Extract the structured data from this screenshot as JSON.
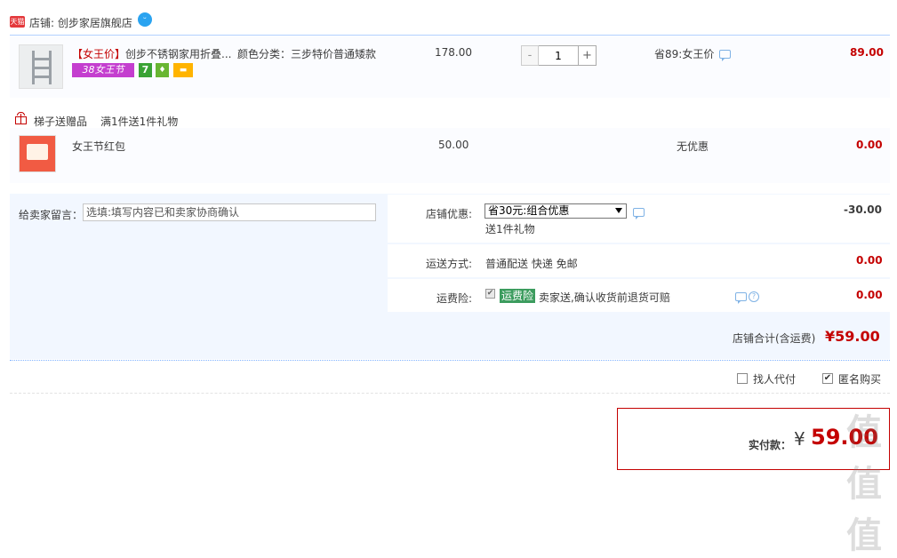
{
  "shop": {
    "badge": "天猫",
    "name": "店铺: 创步家居旗舰店",
    "chat_icon": "wangwang-chat-icon"
  },
  "item": {
    "title_prefix": "【女王价】",
    "title_rest": "创步不锈钢家用折叠...",
    "tag_38": "38女王节",
    "tag_7": "7",
    "tag_bag": "♦",
    "tag_card": "▬",
    "sku": "颜色分类：三步特价普通矮款",
    "price": "178.00",
    "qty_minus": "-",
    "qty": "1",
    "qty_plus": "+",
    "discount": "省89:女王价",
    "subtotal": "89.00"
  },
  "gift": {
    "label": "梯子送赠品",
    "rule": "满1件送1件礼物",
    "title": "女王节红包",
    "price": "50.00",
    "discount": "无优惠",
    "subtotal": "0.00"
  },
  "options": {
    "memo_label": "给卖家留言：",
    "memo_placeholder": "选填:填写内容已和卖家协商确认",
    "promo_label": "店铺优惠:",
    "promo_selected": "省30元:组合优惠",
    "promo_gift": "送1件礼物",
    "promo_amount": "-30.00",
    "ship_label": "运送方式:",
    "ship_value": "普通配送 快递 免邮",
    "ship_amount": "0.00",
    "ins_label": "运费险:",
    "ins_checked": "✔",
    "ins_badge": "运费险",
    "ins_text": "卖家送,确认收货前退货可赔",
    "ins_amount": "0.00",
    "help_glyph": "?"
  },
  "totals": {
    "shop_total_label": "店铺合计(含运费)",
    "shop_total": "¥59.00"
  },
  "checkout": {
    "proxy_pay": "找人代付",
    "anonymous": "匿名购买",
    "anonymous_checked": "✔",
    "pay_label": "实付款：",
    "currency": "¥",
    "pay_amount": "59.00"
  },
  "watermark": "值值值",
  "colors": {
    "accent_red": "#c40000",
    "light_blue_bg": "#f2f7ff",
    "border_blue": "#b2d1ff"
  }
}
